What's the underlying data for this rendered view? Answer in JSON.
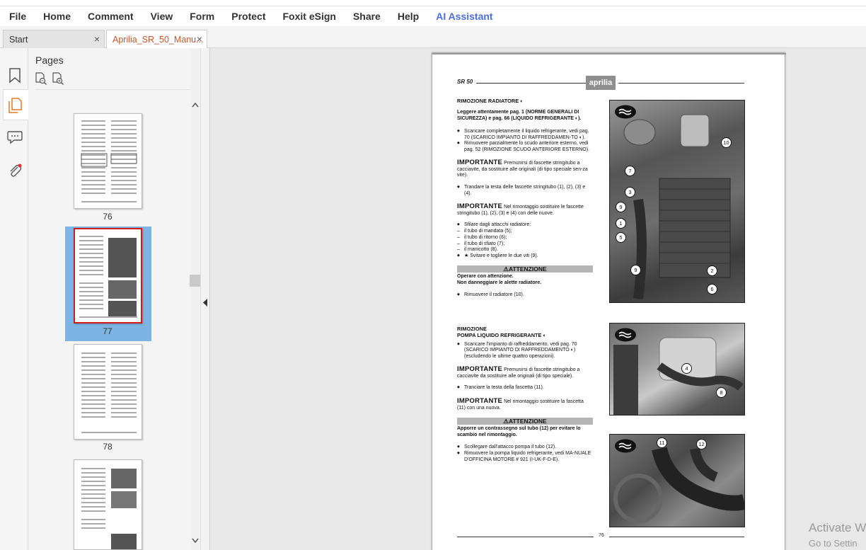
{
  "menu": [
    "File",
    "Home",
    "Comment",
    "View",
    "Form",
    "Protect",
    "Foxit eSign",
    "Share",
    "Help"
  ],
  "menu_ai": "AI Assistant",
  "tabs": {
    "start": "Start",
    "doc": "Aprilia_SR_50_Manu..."
  },
  "tab_close_glyph": "×",
  "panel": {
    "title": "Pages",
    "thumbnails": [
      {
        "label": "76"
      },
      {
        "label": "77"
      },
      {
        "label": "78"
      }
    ]
  },
  "page": {
    "header_label": "SR 50",
    "brand": "aprilia",
    "footer_number": "76",
    "sections": {
      "rimozione_radiatore": {
        "title": "RIMOZIONE RADIATORE",
        "read_note": "Leggere attentamente pag. 1 (NORME GENERALI DI SICUREZZA) e pag. 66 (LIQUIDO REFRIGERANTE",
        "read_note_end": ").",
        "b1": "Scaricare completamente il liquido refrigerante, vedi pag. 70 (SCARICO IMPIANTO DI RAFFREDDAMEN-TO",
        "b1_end": ").",
        "b2": "Rimuovere parzialmente lo scudo anteriore esterno, vedi pag. 52 (RIMOZIONE SCUDO ANTERIORE ESTERNO).",
        "imp1_lead": "IMPORTANTE",
        "imp1": "Premunirsi di fascette stringitubo a cacciavite, da sostituire alle originali (di tipo speciale sen-za vite).",
        "b3": "Trandare la testa delle fascette stringitubo (1), (2), (3) e (4).",
        "imp2_lead": "IMPORTANTE",
        "imp2": "Nel rimontaggio sostituire le fascette stringitubo (1), (2), (3) e (4) con delle nuove.",
        "b4": "Sfilare dagli attacchi radiatore:",
        "d1": "il tubo di mandata (5);",
        "d2": "il tubo di ritorno (6);",
        "d3": "il tubo di sfiato (7);",
        "d4": "il manicotto (8).",
        "b5": "★ Svitare e togliere le due viti (9).",
        "warn": "ATTENZIONE",
        "warn_text": "Operare con attenzione.",
        "warn_text2": "Non danneggiare le alette radiatore.",
        "b6": "Rimuovere il radiatore (10)."
      },
      "pompa": {
        "title1": "RIMOZIONE",
        "title2": "POMPA LIQUIDO REFRIGERANTE",
        "b1": "Scaricare l'impianto di raffreddamento, vedi pag. 70 (SCARICO IMPIANTO DI RAFFREDDAMENTO",
        "b1_end": ") (escludendo le ultime quattro operazioni).",
        "imp1_lead": "IMPORTANTE",
        "imp1": "Premunirsi di fascette stringitubo a cacciavite da sostituire alle originali (di tipo speciale).",
        "b2": "Tranciare la testa della fascetta (11).",
        "imp2_lead": "IMPORTANTE",
        "imp2": "Nel rimontaggio sostituire la fascetta (11) con una nuova.",
        "warn": "ATTENZIONE",
        "warn_text": "Apporre un contrassegno sul tubo (12) per evitare lo scambio nel rimontaggio.",
        "b3": "Scollegare dall'attacco pompa il tubo (12).",
        "b4": "Rimuovere la pompa liquido refrigerante, vedi MA-NUALE D'OFFICINA MOTORE # 921 (I-UK-F-D-E)."
      }
    },
    "callouts_photo1": [
      "10",
      "7",
      "3",
      "9",
      "1",
      "5",
      "9",
      "2",
      "6"
    ],
    "callouts_photo2": [
      "4",
      "8"
    ],
    "callouts_photo3": [
      "11",
      "12"
    ]
  },
  "watermark": {
    "line1": "Activate W",
    "line2": "Go to Settin"
  }
}
